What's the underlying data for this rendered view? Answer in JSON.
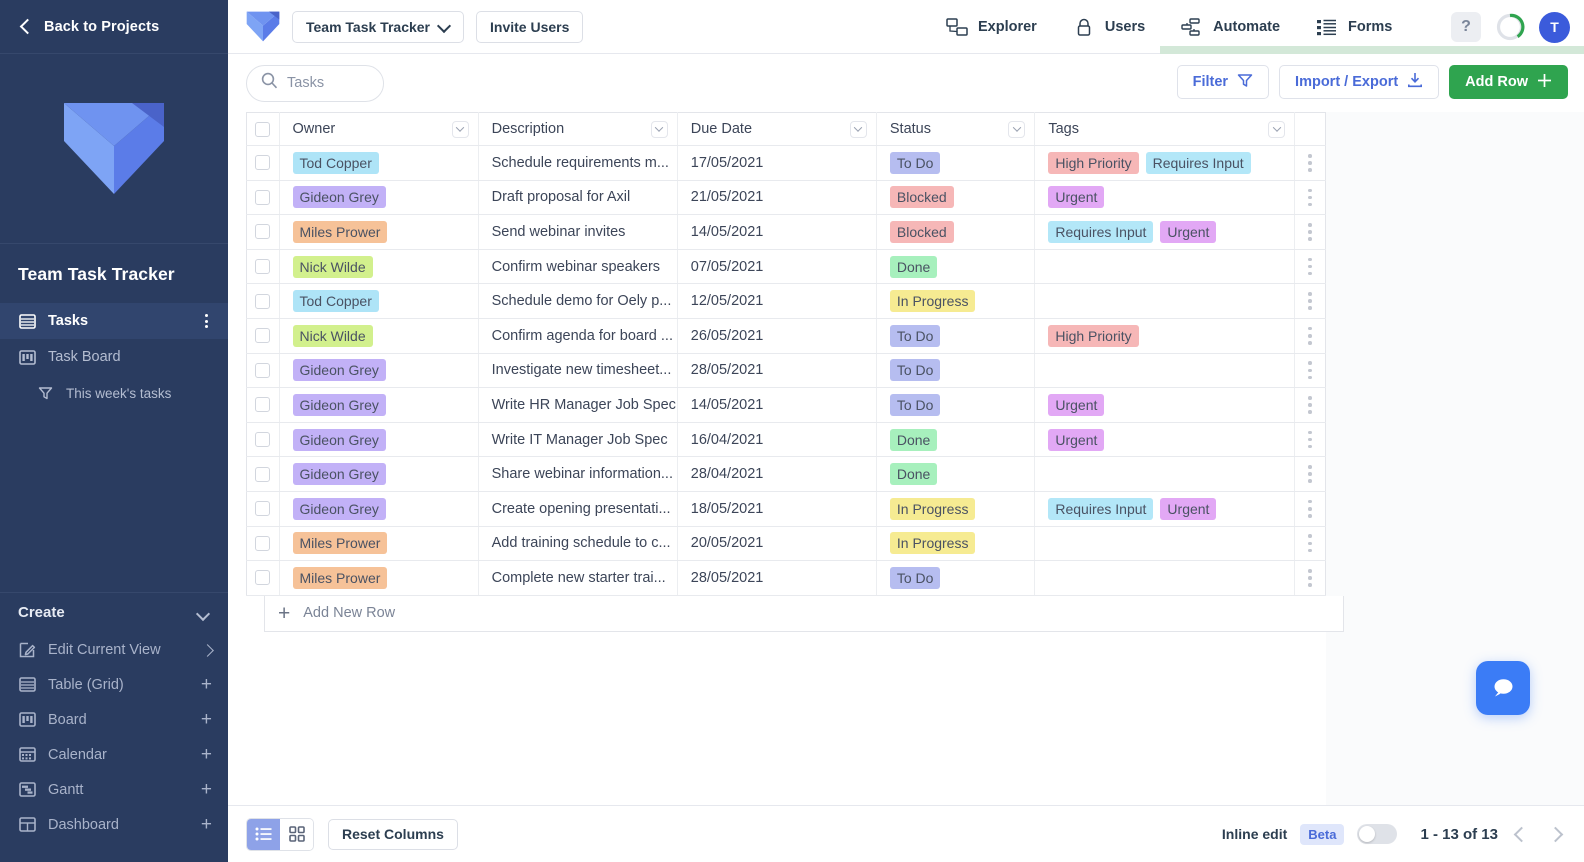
{
  "sidebar": {
    "back_label": "Back to Projects",
    "project_title": "Team Task Tracker",
    "views": [
      {
        "label": "Tasks",
        "icon": "grid-icon",
        "active": true
      },
      {
        "label": "Task Board",
        "icon": "board-icon",
        "active": false
      },
      {
        "label": "This week's tasks",
        "icon": "filter-icon",
        "active": false
      }
    ],
    "create_label": "Create",
    "create_items": [
      {
        "label": "Edit Current View",
        "icon": "edit-icon",
        "trail": "chevron-right-icon"
      },
      {
        "label": "Table (Grid)",
        "icon": "grid-icon",
        "trail": "plus-icon"
      },
      {
        "label": "Board",
        "icon": "board-icon",
        "trail": "plus-icon"
      },
      {
        "label": "Calendar",
        "icon": "calendar-icon",
        "trail": "plus-icon"
      },
      {
        "label": "Gantt",
        "icon": "gantt-icon",
        "trail": "plus-icon"
      },
      {
        "label": "Dashboard",
        "icon": "dashboard-icon",
        "trail": "plus-icon"
      }
    ]
  },
  "topbar": {
    "project_selector": "Team Task Tracker",
    "invite_users": "Invite Users",
    "nav": [
      {
        "label": "Explorer",
        "icon": "explorer-icon",
        "active": true
      },
      {
        "label": "Users",
        "icon": "lock-icon",
        "active": false
      },
      {
        "label": "Automate",
        "icon": "automate-icon",
        "active": false
      },
      {
        "label": "Forms",
        "icon": "forms-icon",
        "active": false
      }
    ],
    "help_label": "?",
    "avatar_initial": "T"
  },
  "toolbar": {
    "search_placeholder": "Tasks",
    "filter_label": "Filter",
    "import_export_label": "Import / Export",
    "add_row_label": "Add Row"
  },
  "table": {
    "columns": [
      "Owner",
      "Description",
      "Due Date",
      "Status",
      "Tags"
    ],
    "rows": [
      {
        "owner": "Tod Copper",
        "owner_color": "#aee4f7",
        "description": "Schedule requirements m...",
        "due": "17/05/2021",
        "status": "To Do",
        "status_color": "#b6bdf0",
        "tags": [
          {
            "label": "High Priority",
            "color": "#f6b7b7"
          },
          {
            "label": "Requires Input",
            "color": "#b3e7f8"
          }
        ]
      },
      {
        "owner": "Gideon Grey",
        "owner_color": "#c2b1f7",
        "description": "Draft proposal for Axil",
        "due": "21/05/2021",
        "status": "Blocked",
        "status_color": "#f6b7b7",
        "tags": [
          {
            "label": "Urgent",
            "color": "#e2a8f5"
          }
        ]
      },
      {
        "owner": "Miles Prower",
        "owner_color": "#f6c298",
        "description": "Send webinar invites",
        "due": "14/05/2021",
        "status": "Blocked",
        "status_color": "#f6b7b7",
        "tags": [
          {
            "label": "Requires Input",
            "color": "#b3e7f8"
          },
          {
            "label": "Urgent",
            "color": "#e2a8f5"
          }
        ]
      },
      {
        "owner": "Nick Wilde",
        "owner_color": "#d2f08d",
        "description": "Confirm webinar speakers",
        "due": "07/05/2021",
        "status": "Done",
        "status_color": "#a7f0bd",
        "tags": []
      },
      {
        "owner": "Tod Copper",
        "owner_color": "#aee4f7",
        "description": "Schedule demo for Oely p...",
        "due": "12/05/2021",
        "status": "In Progress",
        "status_color": "#f6eb92",
        "tags": []
      },
      {
        "owner": "Nick Wilde",
        "owner_color": "#d2f08d",
        "description": "Confirm agenda for board ...",
        "due": "26/05/2021",
        "status": "To Do",
        "status_color": "#b6bdf0",
        "tags": [
          {
            "label": "High Priority",
            "color": "#f6b7b7"
          }
        ]
      },
      {
        "owner": "Gideon Grey",
        "owner_color": "#c2b1f7",
        "description": "Investigate new timesheet...",
        "due": "28/05/2021",
        "status": "To Do",
        "status_color": "#b6bdf0",
        "tags": []
      },
      {
        "owner": "Gideon Grey",
        "owner_color": "#c2b1f7",
        "description": "Write HR Manager Job Spec",
        "due": "14/05/2021",
        "status": "To Do",
        "status_color": "#b6bdf0",
        "tags": [
          {
            "label": "Urgent",
            "color": "#e2a8f5"
          }
        ]
      },
      {
        "owner": "Gideon Grey",
        "owner_color": "#c2b1f7",
        "description": "Write IT Manager Job Spec",
        "due": "16/04/2021",
        "status": "Done",
        "status_color": "#a7f0bd",
        "tags": [
          {
            "label": "Urgent",
            "color": "#e2a8f5"
          }
        ]
      },
      {
        "owner": "Gideon Grey",
        "owner_color": "#c2b1f7",
        "description": "Share webinar information...",
        "due": "28/04/2021",
        "status": "Done",
        "status_color": "#a7f0bd",
        "tags": []
      },
      {
        "owner": "Gideon Grey",
        "owner_color": "#c2b1f7",
        "description": "Create opening presentati...",
        "due": "18/05/2021",
        "status": "In Progress",
        "status_color": "#f6eb92",
        "tags": [
          {
            "label": "Requires Input",
            "color": "#b3e7f8"
          },
          {
            "label": "Urgent",
            "color": "#e2a8f5"
          }
        ]
      },
      {
        "owner": "Miles Prower",
        "owner_color": "#f6c298",
        "description": "Add training schedule to c...",
        "due": "20/05/2021",
        "status": "In Progress",
        "status_color": "#f6eb92",
        "tags": []
      },
      {
        "owner": "Miles Prower",
        "owner_color": "#f6c298",
        "description": "Complete new starter trai...",
        "due": "28/05/2021",
        "status": "To Do",
        "status_color": "#b6bdf0",
        "tags": []
      }
    ],
    "add_new_row_label": "Add New Row"
  },
  "bottombar": {
    "reset_columns_label": "Reset Columns",
    "inline_edit_label": "Inline edit",
    "beta_label": "Beta",
    "pagination_label": "1 - 13 of 13"
  }
}
